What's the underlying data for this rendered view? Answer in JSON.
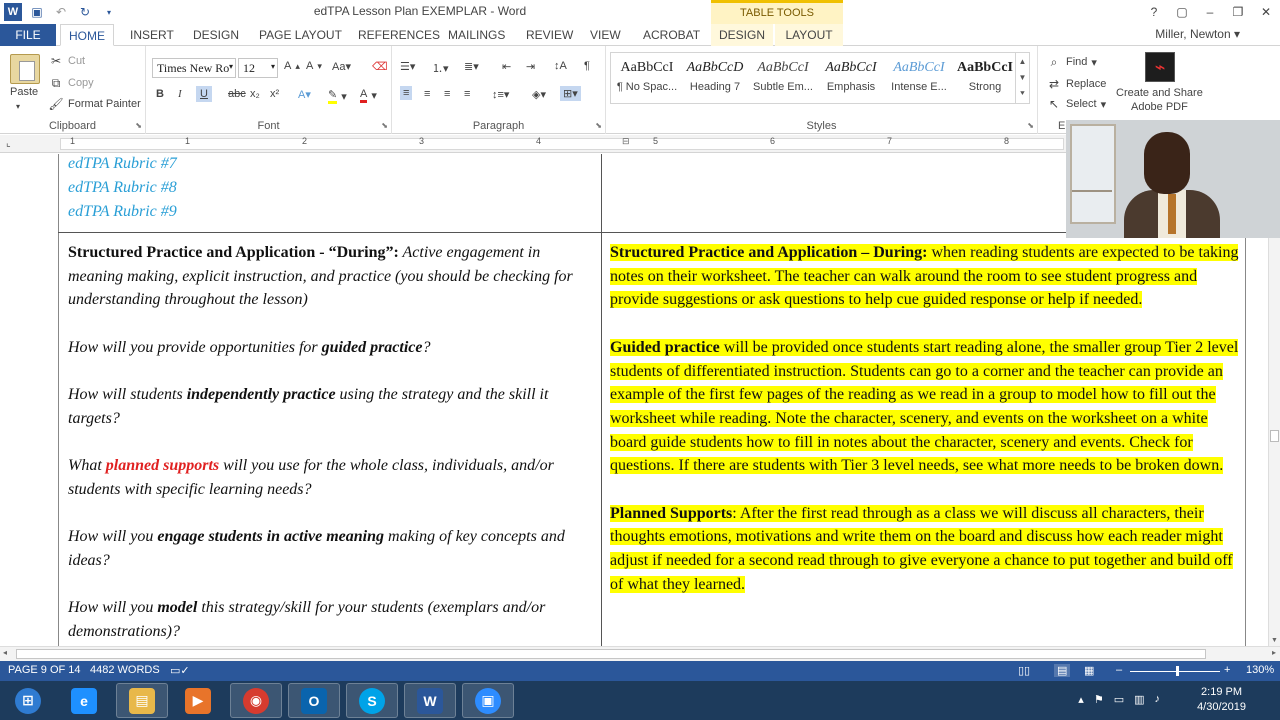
{
  "window": {
    "title": "edTPA Lesson Plan EXEMPLAR - Word",
    "contextual_group": "TABLE TOOLS",
    "controls": [
      "?",
      "▢",
      "–",
      "❐",
      "✕"
    ]
  },
  "ribbon_tabs": [
    "FILE",
    "HOME",
    "INSERT",
    "DESIGN",
    "PAGE LAYOUT",
    "REFERENCES",
    "MAILINGS",
    "REVIEW",
    "VIEW",
    "ACROBAT",
    "DESIGN",
    "LAYOUT"
  ],
  "active_tab": "HOME",
  "user_name": "Miller, Newton",
  "clipboard": {
    "paste": "Paste",
    "cut": "Cut",
    "copy": "Copy",
    "format_painter": "Format Painter",
    "label": "Clipboard"
  },
  "font": {
    "family": "Times New Ro",
    "size": "12",
    "label": "Font"
  },
  "paragraph": {
    "label": "Paragraph"
  },
  "styles": {
    "label": "Styles",
    "items": [
      {
        "sample": "AaBbCcI",
        "name": "¶ No Spac...",
        "italic": false,
        "bold": false,
        "color": "#222"
      },
      {
        "sample": "AaBbCcD",
        "name": "Heading 7",
        "italic": true,
        "bold": false,
        "color": "#222"
      },
      {
        "sample": "AaBbCcI",
        "name": "Subtle Em...",
        "italic": true,
        "bold": false,
        "color": "#444"
      },
      {
        "sample": "AaBbCcI",
        "name": "Emphasis",
        "italic": true,
        "bold": false,
        "color": "#222"
      },
      {
        "sample": "AaBbCcI",
        "name": "Intense E...",
        "italic": true,
        "bold": false,
        "color": "#5b9bd5"
      },
      {
        "sample": "AaBbCcI",
        "name": "Strong",
        "italic": false,
        "bold": true,
        "color": "#222"
      }
    ]
  },
  "editing": {
    "find": "Find",
    "replace": "Replace",
    "select": "Select",
    "label": "E"
  },
  "adobe": {
    "line1": "Create and Share",
    "line2": "Adobe PDF"
  },
  "ruler_numbers": [
    "1",
    "1",
    "2",
    "3",
    "4",
    "5",
    "6",
    "7",
    "8"
  ],
  "document": {
    "rubrics": [
      "edTPA Rubric #7",
      "edTPA Rubric #8",
      "edTPA Rubric #9"
    ],
    "left": {
      "heading_bold": "Structured Practice and Application - “During”:",
      "heading_rest": " Active engagement in meaning making, explicit instruction, and practice (you should be checking for understanding throughout the lesson)",
      "q1_a": "How will you provide opportunities for ",
      "q1_b": "guided practice",
      "q1_c": "?",
      "q2_a": "How will students ",
      "q2_b": "independently practice",
      "q2_c": " using the strategy and the skill it targets?",
      "q3_a": "What ",
      "q3_b": "planned supports",
      "q3_c": " will you use for the whole class, individuals, and/or students with specific learning needs?",
      "q4_a": "How will you ",
      "q4_b": "engage students in active meaning",
      "q4_c": " making of key concepts and ideas?",
      "q5_a": "How will you ",
      "q5_b": "model",
      "q5_c": " this strategy/skill for your students (exemplars and/or demonstrations)?"
    },
    "right": {
      "p1_bold": "Structured Practice and Application – During:",
      "p1_rest": " when reading students are expected to be taking notes on their worksheet. The teacher can walk around the room to see student progress and provide suggestions or ask questions to help cue guided response or help if needed.",
      "p2_bold": "Guided practice",
      "p2_rest": " will be provided once students start reading alone, the smaller group Tier 2 level students of differentiated instruction.  Students can go to a corner and the teacher can provide an example of the first few pages of the reading as we read in a group to model how to fill out the worksheet while reading.  Note the character, scenery, and events on the worksheet on a white board guide students how to fill in notes about the character, scenery and events.  Check for questions. If there are students with Tier 3 level needs, see what more needs to be broken down.",
      "p3_bold": "Planned Supports",
      "p3_rest": ": After the first read through as a class we will discuss all characters, their thoughts emotions, motivations and write them on the board and discuss how each reader might adjust if needed for a second read through to give everyone a chance to put together and build off of what they learned."
    }
  },
  "status": {
    "page": "PAGE 9 OF 14",
    "words": "4482 WORDS",
    "zoom": "130%"
  },
  "taskbar": {
    "apps": [
      {
        "name": "start",
        "glyph": "⊞",
        "color": "#2f7bd1"
      },
      {
        "name": "internet-explorer",
        "glyph": "e",
        "color": "#1e90ff"
      },
      {
        "name": "file-explorer",
        "glyph": "▤",
        "color": "#e8b84a"
      },
      {
        "name": "media-player",
        "glyph": "▶",
        "color": "#e8742a"
      },
      {
        "name": "chrome",
        "glyph": "◉",
        "color": "#d63b2f"
      },
      {
        "name": "outlook",
        "glyph": "O",
        "color": "#0a64ad"
      },
      {
        "name": "skype",
        "glyph": "S",
        "color": "#00a3e8"
      },
      {
        "name": "word",
        "glyph": "W",
        "color": "#2b579a"
      },
      {
        "name": "zoom",
        "glyph": "▣",
        "color": "#2d8cff"
      }
    ],
    "time": "2:19 PM",
    "date": "4/30/2019"
  }
}
